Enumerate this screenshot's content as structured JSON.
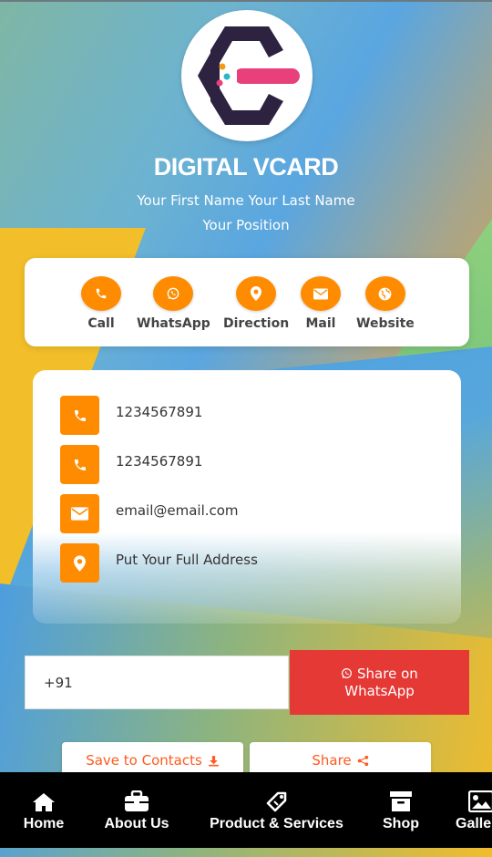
{
  "profile": {
    "title": "DIGITAL VCARD",
    "name": "Your First Name Your Last Name",
    "position": "Your Position",
    "logo_icon": "vcard-logo-icon"
  },
  "actions": [
    {
      "label": "Call",
      "icon": "phone-icon"
    },
    {
      "label": "WhatsApp",
      "icon": "whatsapp-icon"
    },
    {
      "label": "Direction",
      "icon": "map-pin-icon"
    },
    {
      "label": "Mail",
      "icon": "envelope-icon"
    },
    {
      "label": "Website",
      "icon": "globe-icon"
    }
  ],
  "contacts": [
    {
      "value": "1234567891",
      "icon": "phone-icon"
    },
    {
      "value": "1234567891",
      "icon": "phone-icon"
    },
    {
      "value": "email@email.com",
      "icon": "envelope-icon"
    },
    {
      "value": "Put Your Full Address",
      "icon": "map-pin-icon"
    }
  ],
  "whatsapp_share": {
    "input_value": "+91",
    "button_line1": "Share on",
    "button_line2": "WhatsApp"
  },
  "buttons": {
    "save_contacts": "Save to Contacts",
    "share": "Share"
  },
  "nav": [
    {
      "label": "Home",
      "icon": "home-icon"
    },
    {
      "label": "About Us",
      "icon": "briefcase-icon"
    },
    {
      "label": "Product & Services",
      "icon": "tag-icon"
    },
    {
      "label": "Shop",
      "icon": "archive-icon"
    },
    {
      "label": "Gallery",
      "icon": "image-icon"
    }
  ],
  "colors": {
    "accent": "#ff8c00",
    "share_button": "#e53935",
    "nav_background": "#000000",
    "logo_ring": "#2d2240",
    "logo_bar": "#e8407a"
  }
}
